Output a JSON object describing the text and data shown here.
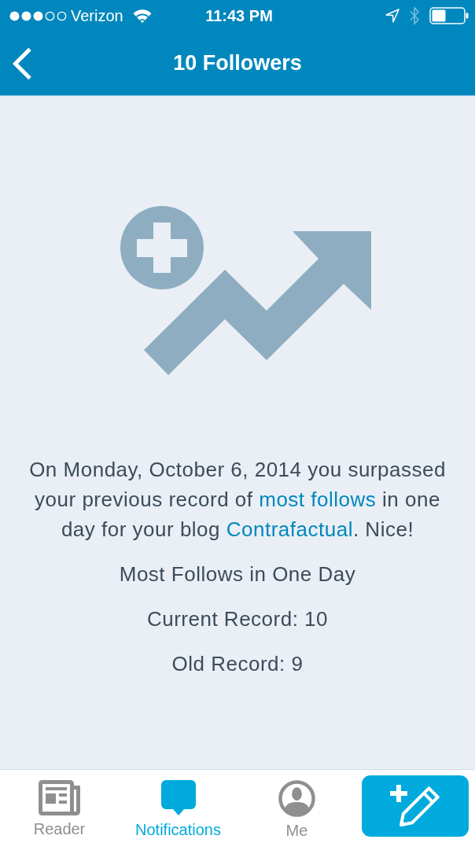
{
  "status_bar": {
    "carrier": "Verizon",
    "time": "11:43 PM"
  },
  "nav_bar": {
    "title": "10 Followers"
  },
  "message": {
    "parts": [
      {
        "kind": "text",
        "text": "On Monday, October 6, 2014 you surpassed your previous record of "
      },
      {
        "kind": "link",
        "text": "most follows"
      },
      {
        "kind": "text",
        "text": " in one day for your blog "
      },
      {
        "kind": "link",
        "text": "Contrafactual"
      },
      {
        "kind": "text",
        "text": ". Nice!"
      }
    ]
  },
  "record": {
    "heading": "Most Follows in One Day",
    "current": "Current Record: 10",
    "old": "Old Record: 9"
  },
  "tab_bar": {
    "tabs": [
      {
        "label": "Reader",
        "selected": false
      },
      {
        "label": "Notifications",
        "selected": true
      },
      {
        "label": "Me",
        "selected": false
      }
    ]
  }
}
